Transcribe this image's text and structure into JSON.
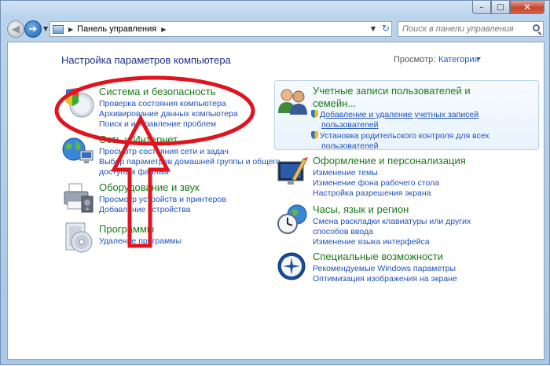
{
  "window": {
    "minimize": "–",
    "maximize": "□",
    "close": "✕"
  },
  "nav": {
    "back_icon": "◀",
    "forward_icon": "➔",
    "dropdown": "▼",
    "breadcrumb_sep": "▶",
    "breadcrumb": "Панель управления",
    "refresh_icon": "↻",
    "search_placeholder": "Поиск в панели управления"
  },
  "header": {
    "title": "Настройка параметров компьютера",
    "view_label": "Просмотр:",
    "view_value": "Категория"
  },
  "categories_left": [
    {
      "title": "Система и безопасность",
      "icon": "shield-security-icon",
      "links": [
        "Проверка состояния компьютера",
        "Архивирование данных компьютера",
        "Поиск и исправление проблем"
      ]
    },
    {
      "title": "Сеть и Интернет",
      "icon": "network-globe-icon",
      "links": [
        "Просмотр состояния сети и задач",
        "Выбор параметров домашней группы и общего",
        "доступа к файлам"
      ]
    },
    {
      "title": "Оборудование и звук",
      "icon": "printer-icon",
      "links": [
        "Просмотр устройств и принтеров",
        "Добавление устройства"
      ]
    },
    {
      "title": "Программы",
      "icon": "programs-disc-icon",
      "links": [
        "Удаление программы"
      ]
    }
  ],
  "categories_right": [
    {
      "title": "Учетные записи пользователей и",
      "title2": "семейн...",
      "icon": "users-icon",
      "links": [
        "Добавление и удаление учетных записей",
        "пользователей",
        "Установка родительского контроля для всех",
        "пользователей"
      ]
    },
    {
      "title": "Оформление и персонализация",
      "icon": "personalization-icon",
      "links": [
        "Изменение темы",
        "Изменение фона рабочего стола",
        "Настройка разрешения экрана"
      ]
    },
    {
      "title": "Часы, язык и регион",
      "icon": "clock-globe-icon",
      "links": [
        "Смена раскладки клавиатуры или других",
        "способов ввода",
        "Изменение языка интерфейса"
      ]
    },
    {
      "title": "Специальные возможности",
      "icon": "accessibility-icon",
      "links": [
        "Рекомендуемые Windows параметры",
        "Оптимизация изображения на экране"
      ]
    }
  ],
  "colors": {
    "category_title": "#1a7a1a",
    "link": "#1e50c0",
    "annotation": "#e0141e"
  }
}
